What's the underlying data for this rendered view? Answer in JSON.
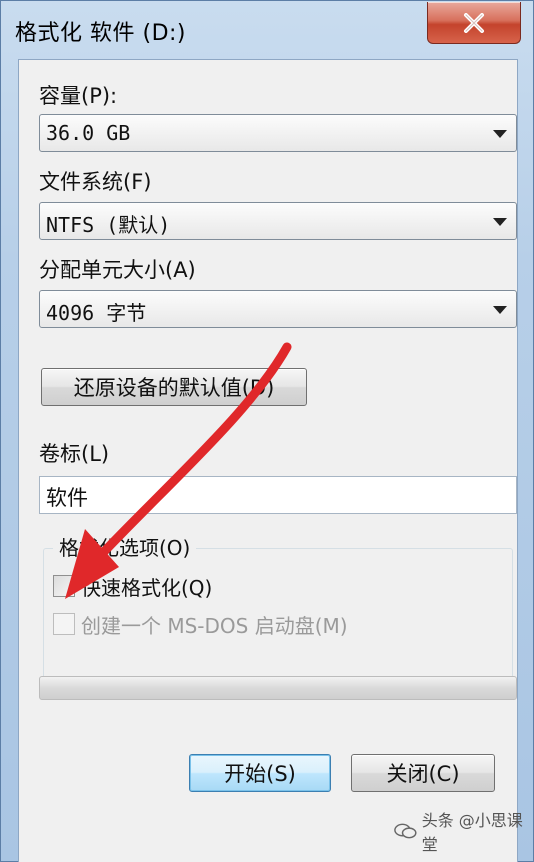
{
  "window": {
    "title": "格式化 软件 (D:)",
    "close_icon": "close-icon"
  },
  "capacity": {
    "label": "容量(P):",
    "value": "36.0 GB"
  },
  "filesystem": {
    "label": "文件系统(F)",
    "value": "NTFS (默认)"
  },
  "allocation": {
    "label": "分配单元大小(A)",
    "value": "4096 字节"
  },
  "restore_button": "还原设备的默认值(D)",
  "volume": {
    "label": "卷标(L)",
    "value": "软件"
  },
  "format_options": {
    "legend": "格式化选项(O)",
    "quick_format": {
      "label": "快速格式化(Q)",
      "checked": false
    },
    "msdos_disk": {
      "label": "创建一个 MS-DOS 启动盘(M)",
      "checked": false,
      "disabled": true
    }
  },
  "progress": {
    "value": 0
  },
  "buttons": {
    "start": "开始(S)",
    "close": "关闭(C)"
  },
  "watermark": {
    "text": "头条 @小思课堂",
    "overlay_text": "小思课堂"
  },
  "colors": {
    "annotation_arrow": "#e0282a",
    "title_bar": "#b9d1ea",
    "close_button": "#c4432c"
  }
}
